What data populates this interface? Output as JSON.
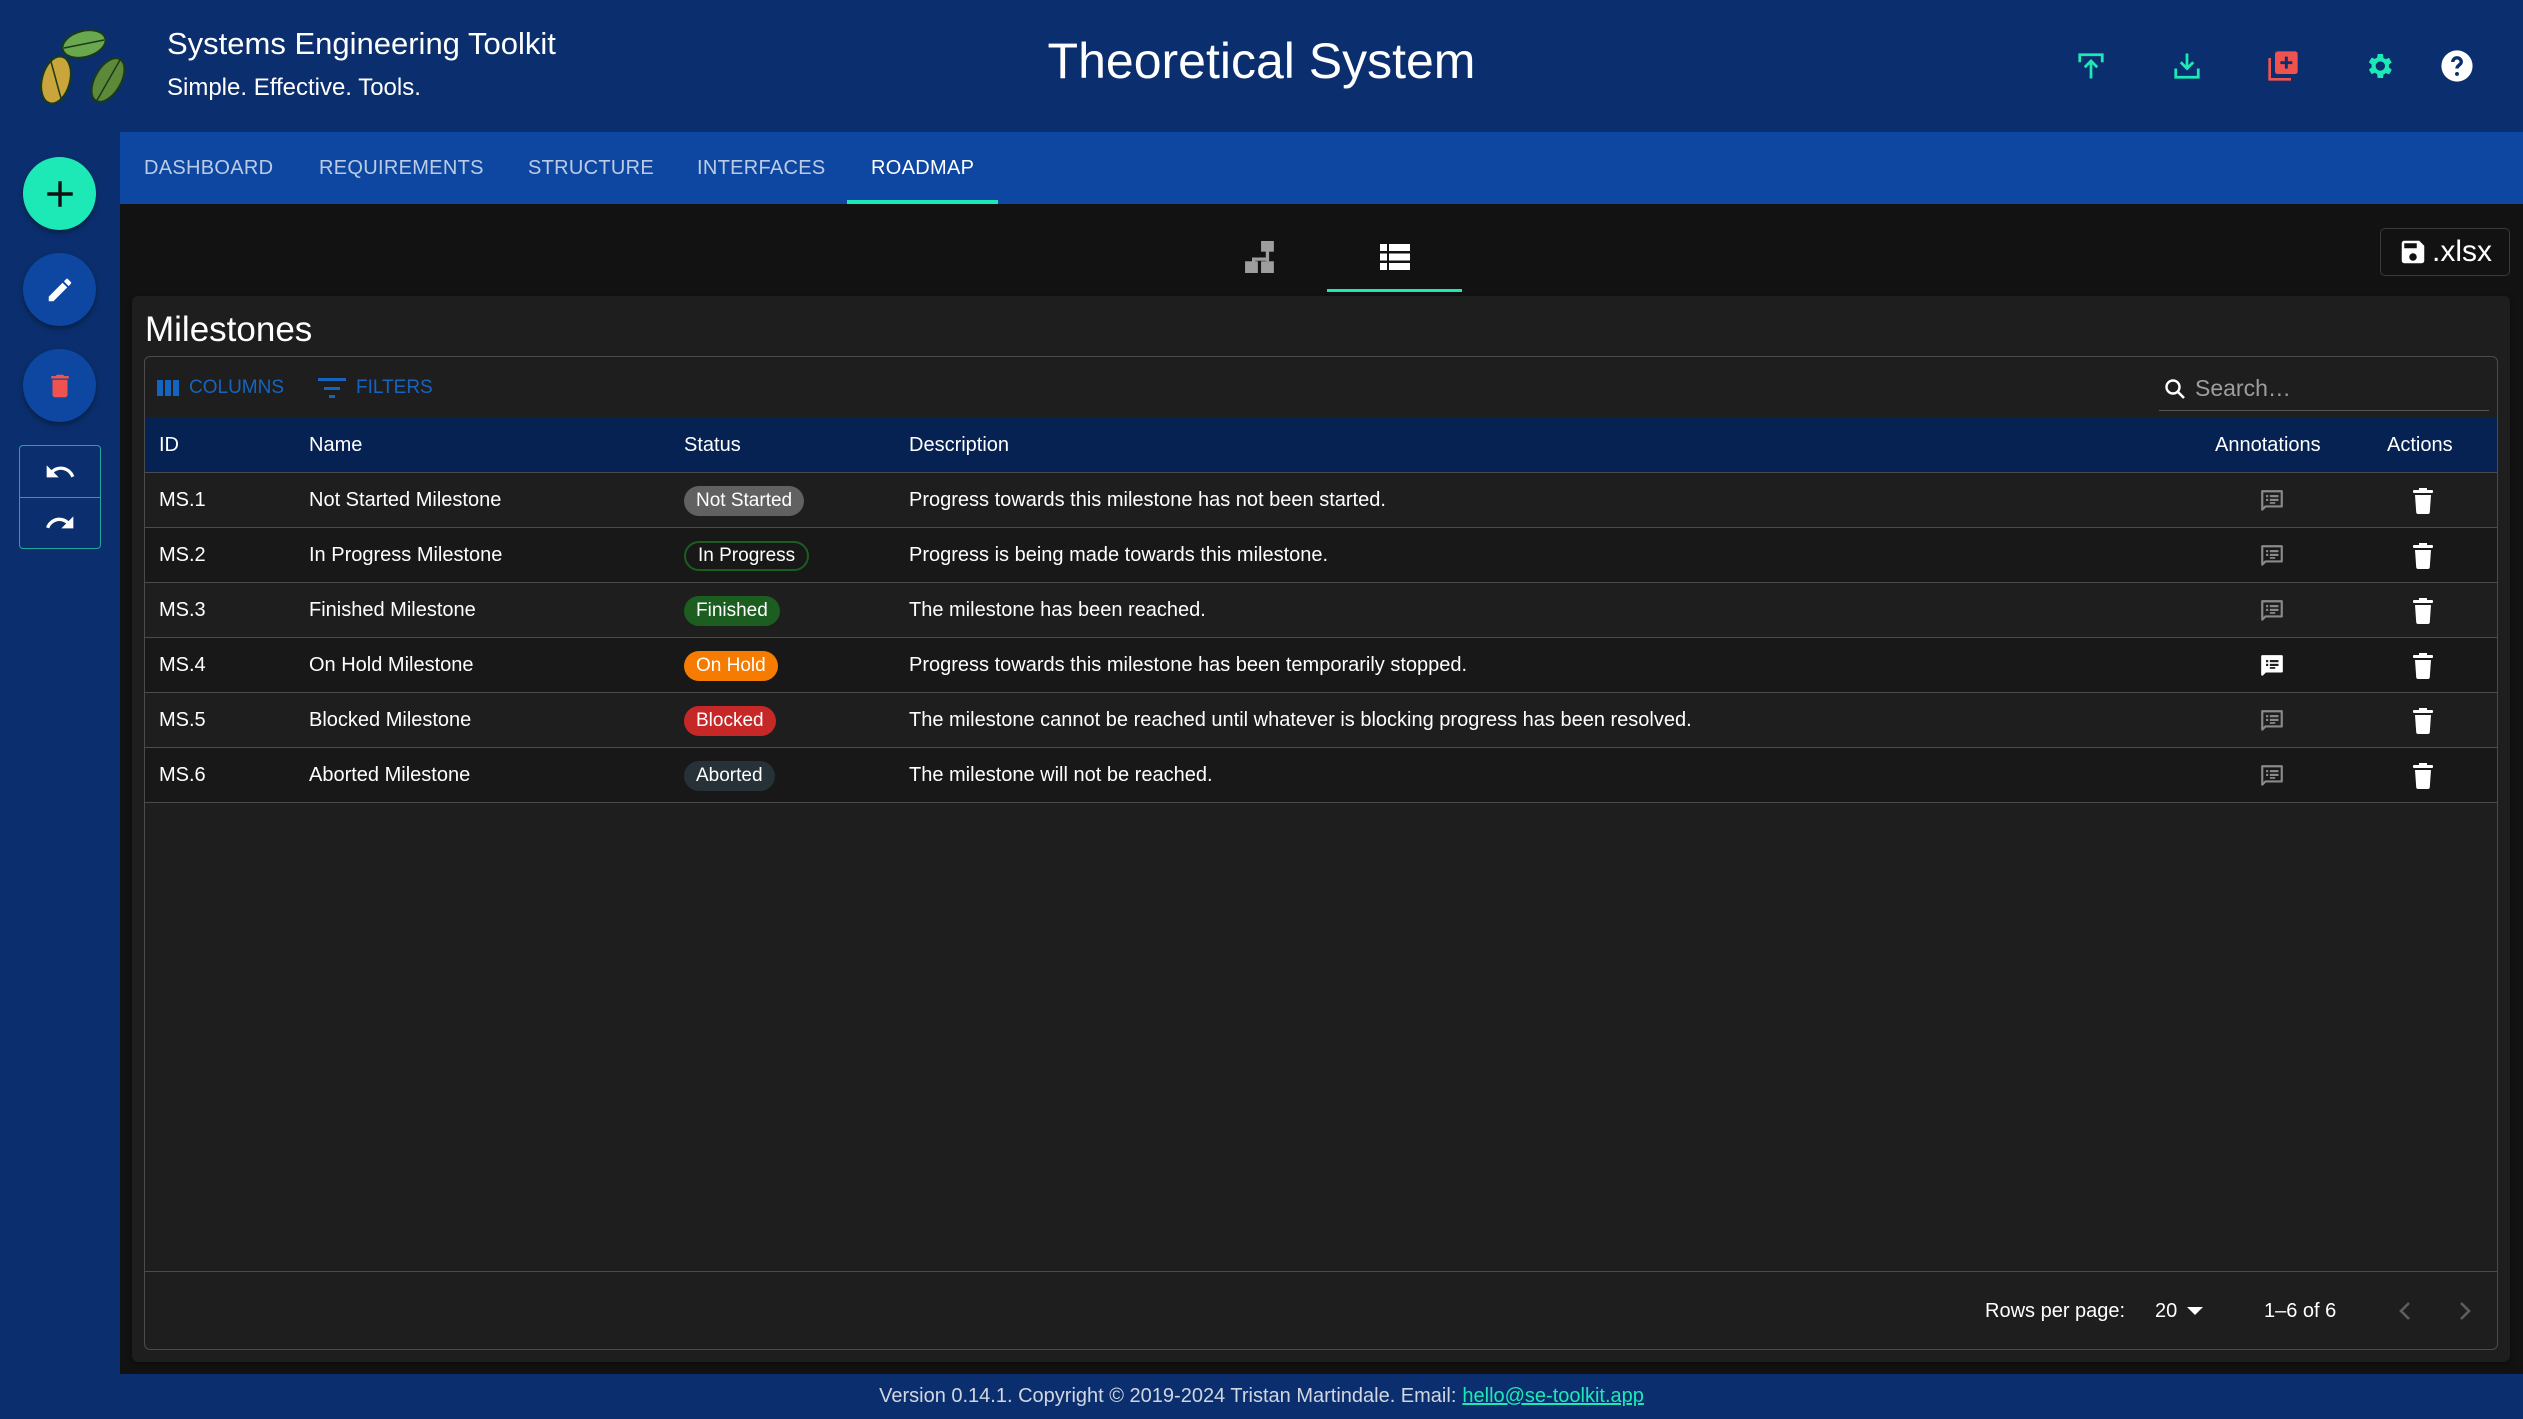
{
  "header": {
    "app_title": "Systems Engineering Toolkit",
    "app_subtitle": "Simple. Effective. Tools.",
    "project_title": "Theoretical System",
    "actions": [
      {
        "name": "upload-icon",
        "label": "Upload"
      },
      {
        "name": "download-icon",
        "label": "Download"
      },
      {
        "name": "new-project-icon",
        "label": "New"
      },
      {
        "name": "settings-icon",
        "label": "Settings"
      },
      {
        "name": "help-icon",
        "label": "Help"
      }
    ]
  },
  "colors": {
    "primary_dark": "#0b2f6e",
    "primary": "#0d47a1",
    "accent": "#1de9b6",
    "danger": "#ef5350",
    "table_header": "#062253",
    "background": "#121212",
    "surface": "#1e1e1e"
  },
  "sidebar": {
    "buttons": [
      {
        "name": "add-button",
        "icon": "plus-icon"
      },
      {
        "name": "edit-button",
        "icon": "pencil-icon"
      },
      {
        "name": "delete-button",
        "icon": "trash-icon"
      },
      {
        "name": "undo-button",
        "icon": "undo-icon"
      },
      {
        "name": "redo-button",
        "icon": "redo-icon"
      }
    ]
  },
  "nav": {
    "tabs": [
      {
        "label": "DASHBOARD",
        "active": false
      },
      {
        "label": "REQUIREMENTS",
        "active": false
      },
      {
        "label": "STRUCTURE",
        "active": false
      },
      {
        "label": "INTERFACES",
        "active": false
      },
      {
        "label": "ROADMAP",
        "active": true
      }
    ]
  },
  "views": {
    "toggles": [
      {
        "name": "diagram-view",
        "icon": "sitemap-icon",
        "active": false
      },
      {
        "name": "table-view",
        "icon": "list-icon",
        "active": true
      }
    ],
    "export_label": ".xlsx"
  },
  "milestones": {
    "title": "Milestones",
    "toolbar": {
      "columns_label": "COLUMNS",
      "filters_label": "FILTERS",
      "search_placeholder": "Search…",
      "search_value": ""
    },
    "columns": [
      "ID",
      "Name",
      "Status",
      "Description",
      "Annotations",
      "Actions"
    ],
    "rows": [
      {
        "id": "MS.1",
        "name": "Not Started Milestone",
        "status": "Not Started",
        "status_color": "#616161",
        "status_style": "filled",
        "description": "Progress towards this milestone has not been started.",
        "has_annotations": false
      },
      {
        "id": "MS.2",
        "name": "In Progress Milestone",
        "status": "In Progress",
        "status_color": "#1b5e20",
        "status_style": "outlined",
        "description": "Progress is being made towards this milestone.",
        "has_annotations": false
      },
      {
        "id": "MS.3",
        "name": "Finished Milestone",
        "status": "Finished",
        "status_color": "#1b5e20",
        "status_style": "filled",
        "description": "The milestone has been reached.",
        "has_annotations": false
      },
      {
        "id": "MS.4",
        "name": "On Hold Milestone",
        "status": "On Hold",
        "status_color": "#f57c00",
        "status_style": "filled",
        "description": "Progress towards this milestone has been temporarily stopped.",
        "has_annotations": true
      },
      {
        "id": "MS.5",
        "name": "Blocked Milestone",
        "status": "Blocked",
        "status_color": "#c62828",
        "status_style": "filled",
        "description": "The milestone cannot be reached until whatever is blocking progress has been resolved.",
        "has_annotations": false
      },
      {
        "id": "MS.6",
        "name": "Aborted Milestone",
        "status": "Aborted",
        "status_color": "#263238",
        "status_style": "filled",
        "description": "The milestone will not be reached.",
        "has_annotations": false
      }
    ],
    "pagination": {
      "rows_per_page_label": "Rows per page:",
      "rows_per_page": "20",
      "range": "1–6 of 6"
    }
  },
  "footer": {
    "text": "Version 0.14.1. Copyright © 2019-2024 Tristan Martindale. Email:",
    "email": "hello@se-toolkit.app"
  }
}
